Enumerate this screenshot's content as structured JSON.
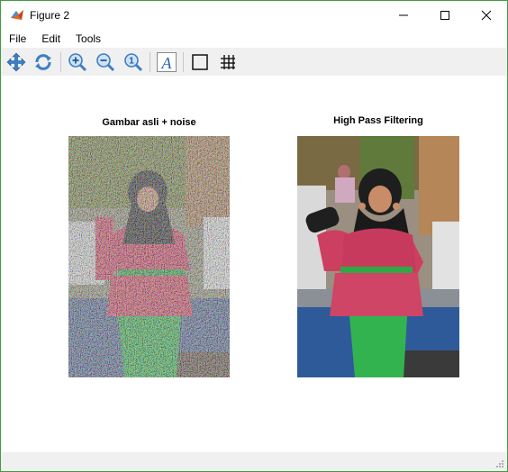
{
  "window": {
    "title": "Figure 2",
    "accent": "#3f9a3f"
  },
  "menu": {
    "items": [
      "File",
      "Edit",
      "Tools"
    ]
  },
  "toolbar": {
    "tools": [
      {
        "name": "pan",
        "icon": "pan-arrows-icon"
      },
      {
        "name": "rotate",
        "icon": "rotate-3d-icon"
      },
      {
        "name": "zoom-in",
        "icon": "zoom-in-icon"
      },
      {
        "name": "zoom-out",
        "icon": "zoom-out-icon"
      },
      {
        "name": "zoom-reset",
        "icon": "zoom-reset-icon"
      },
      {
        "name": "annotate",
        "icon": "text-annotation-icon"
      },
      {
        "name": "frame",
        "icon": "frame-icon"
      },
      {
        "name": "grid",
        "icon": "grid-icon"
      }
    ]
  },
  "figure": {
    "left_title": "Gambar asli + noise",
    "right_title": "High Pass Filtering"
  }
}
